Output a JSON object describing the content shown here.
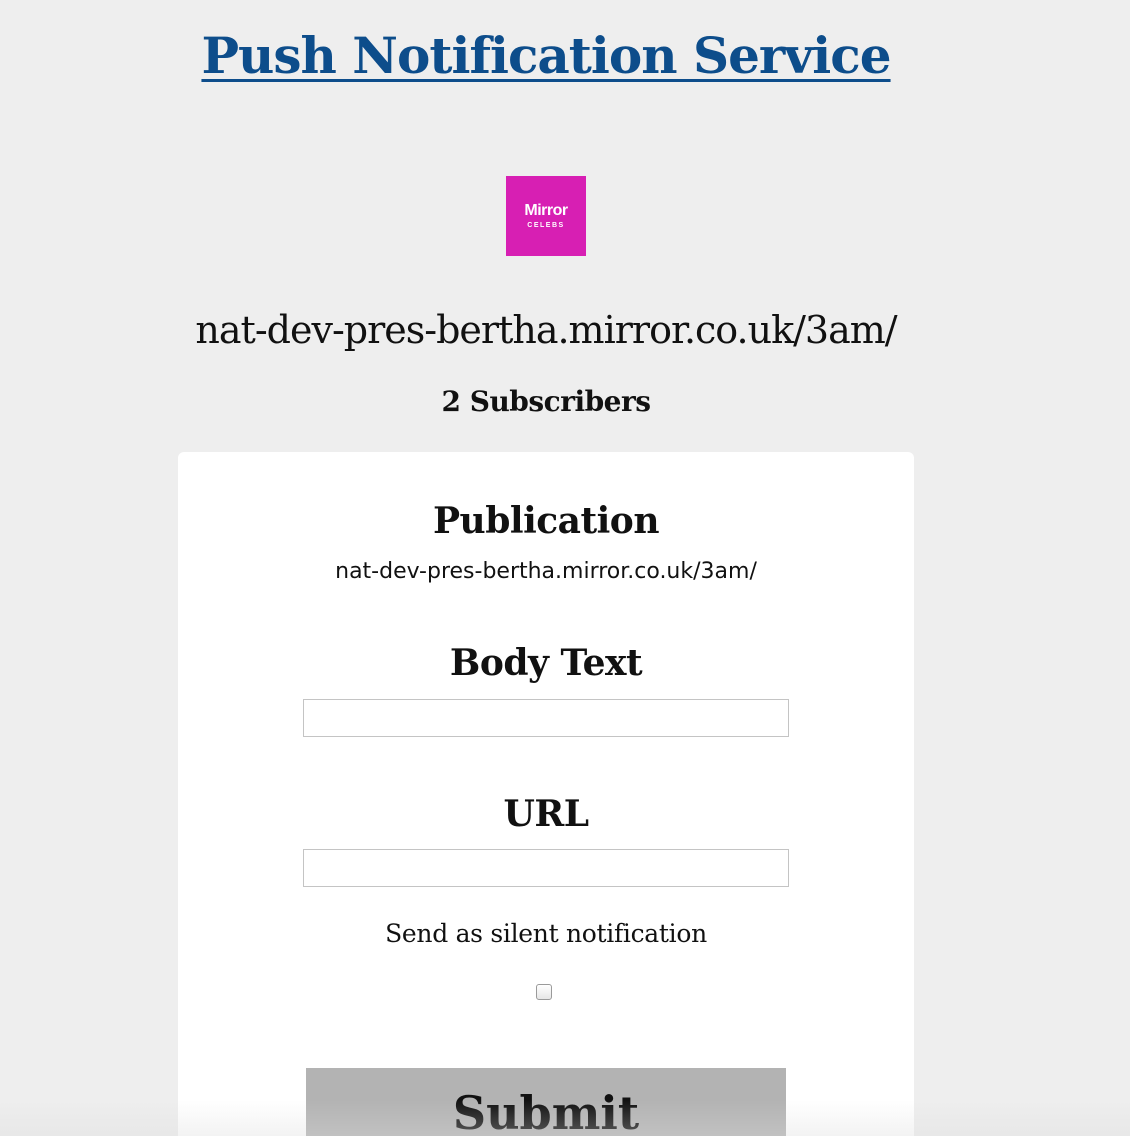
{
  "header": {
    "title": "Push Notification Service"
  },
  "logo": {
    "brand": "Mirror",
    "sub": "CELEBS",
    "color": "#d71fb3"
  },
  "publication_heading": "nat-dev-pres-bertha.mirror.co.uk/3am/",
  "subscribers": "2 Subscribers",
  "form": {
    "publication_label": "Publication",
    "publication_value": "nat-dev-pres-bertha.mirror.co.uk/3am/",
    "body_text_label": "Body Text",
    "body_text_value": "",
    "url_label": "URL",
    "url_value": "",
    "silent_label": "Send as silent notification",
    "silent_checked": false,
    "submit_label": "Submit"
  },
  "colors": {
    "background": "#eeeeee",
    "title_link": "#0d4d8b",
    "card": "#ffffff",
    "submit_button": "#b3b3b3"
  }
}
